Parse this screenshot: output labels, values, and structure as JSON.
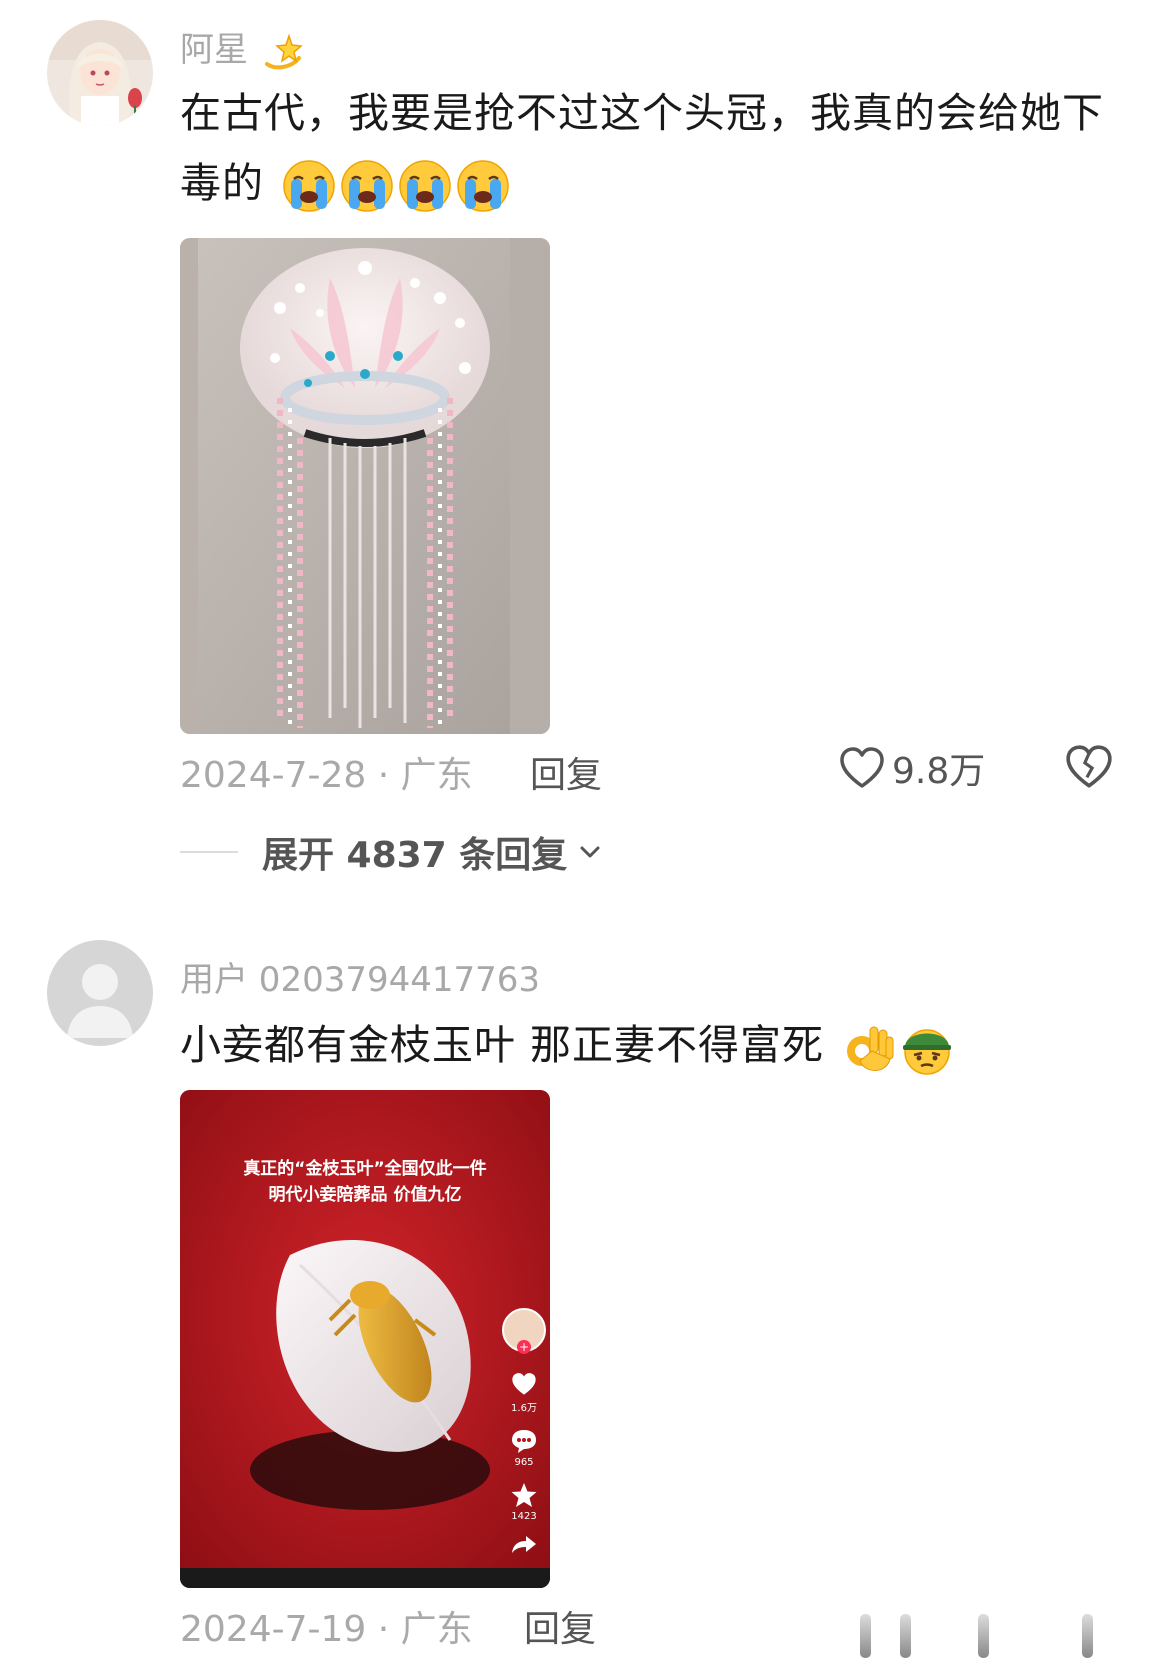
{
  "comments": [
    {
      "username": "阿星",
      "username_emoji": "dizzy-star",
      "text": "在古代，我要是抢不过这个头冠，我真的会给她下毒的",
      "text_emojis": [
        "loudly-crying-face",
        "loudly-crying-face",
        "loudly-crying-face",
        "loudly-crying-face"
      ],
      "photo_subject": "phoenix crown headdress on display",
      "date_location": "2024-7-28 · 广东",
      "reply_label": "回复",
      "likes": "9.8万",
      "expand_label": "展开 4837 条回复"
    },
    {
      "username": "用户 0203794417763",
      "text": "小妾都有金枝玉叶 那正妻不得富死",
      "text_emojis": [
        "ok-hand",
        "face-with-helmet"
      ],
      "photo": {
        "caption_line1": "真正的“金枝玉叶”全国仅此一件",
        "caption_line2": "明代小妾陪葬品 价值九亿",
        "like_count": "1.6万",
        "comment_count": "965",
        "fav_count": "1423"
      },
      "date_location": "2024-7-19 · 广东",
      "reply_label": "回复"
    }
  ],
  "colors": {
    "meta_gray": "#a9a9a9",
    "action_gray": "#555555",
    "photo_red": "#b3161c"
  }
}
